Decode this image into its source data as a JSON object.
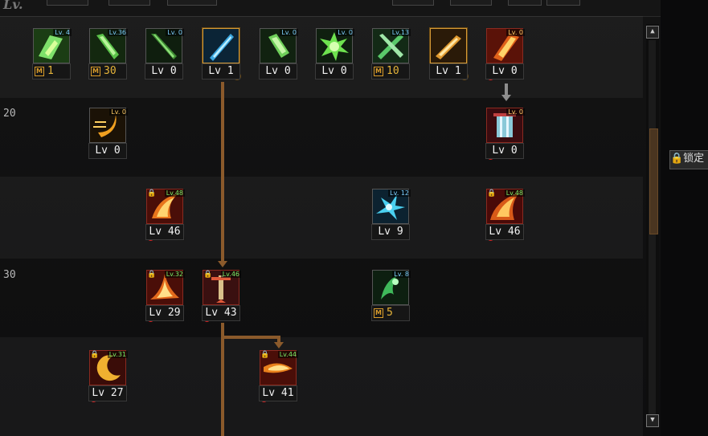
{
  "header": {
    "level_label": "Lv."
  },
  "rows": [
    {
      "level": ""
    },
    {
      "level": "20"
    },
    {
      "level": ""
    },
    {
      "level": "30"
    },
    {
      "level": ""
    }
  ],
  "side": {
    "lock_label": "🔒锁定"
  },
  "skills": [
    {
      "id": "s1",
      "badge": "Lv. 4",
      "caption": "1",
      "mastery": true,
      "icon": "leaf-slash-icon"
    },
    {
      "id": "s2",
      "badge": "Lv.36",
      "caption": "30",
      "mastery": true,
      "icon": "green-blade-icon"
    },
    {
      "id": "s3",
      "badge": "Lv. 0",
      "caption": "Lv 0",
      "mastery": false,
      "icon": "green-sword-icon"
    },
    {
      "id": "s4",
      "badge": "",
      "caption": "Lv 1",
      "mastery": false,
      "icon": "blue-sword-icon"
    },
    {
      "id": "s5",
      "badge": "Lv. 0",
      "caption": "Lv 0",
      "mastery": false,
      "icon": "green-shield-icon"
    },
    {
      "id": "s6",
      "badge": "Lv. 0",
      "caption": "Lv 0",
      "mastery": false,
      "icon": "green-burst-icon"
    },
    {
      "id": "s7",
      "badge": "Lv.13",
      "caption": "10",
      "mastery": true,
      "icon": "cross-blades-icon"
    },
    {
      "id": "s8",
      "badge": "",
      "caption": "Lv 1",
      "mastery": false,
      "icon": "golden-slash-icon"
    },
    {
      "id": "s9",
      "badge": "Lv. 0",
      "caption": "Lv 0",
      "mastery": false,
      "icon": "fire-strike-icon"
    },
    {
      "id": "s10",
      "badge": "Lv. 0",
      "caption": "Lv 0",
      "mastery": false,
      "icon": "crescent-dash-icon"
    },
    {
      "id": "s11",
      "badge": "Lv. 0",
      "caption": "Lv 0",
      "mastery": false,
      "icon": "armor-buff-icon"
    },
    {
      "id": "s12",
      "badge": "Lv.48",
      "caption": "Lv 46",
      "mastery": false,
      "icon": "flame-wave-icon",
      "hotkey": "A"
    },
    {
      "id": "s13",
      "badge": "Lv. 12",
      "caption": "Lv 9",
      "mastery": false,
      "icon": "ice-splash-icon"
    },
    {
      "id": "s14",
      "badge": "Lv.48",
      "caption": "Lv 46",
      "mastery": false,
      "icon": "flame-storm-icon",
      "hotkey": "Shift"
    },
    {
      "id": "s15",
      "badge": "Lv.32",
      "caption": "Lv 29",
      "mastery": false,
      "icon": "flame-cleave-icon",
      "hotkey": "F"
    },
    {
      "id": "s16",
      "badge": "Lv.46",
      "caption": "Lv 43",
      "mastery": false,
      "icon": "pillar-blade-icon",
      "hotkey": "FF"
    },
    {
      "id": "s17",
      "badge": "Lv. 8",
      "caption": "5",
      "mastery": true,
      "icon": "green-spirit-icon"
    },
    {
      "id": "s18",
      "badge": "Lv.31",
      "caption": "Lv 27",
      "mastery": false,
      "icon": "crescent-moon-icon",
      "hotkey": "W"
    },
    {
      "id": "s19",
      "badge": "Lv.44",
      "caption": "Lv 41",
      "mastery": false,
      "icon": "flame-dash-icon",
      "hotkey": "E"
    }
  ]
}
